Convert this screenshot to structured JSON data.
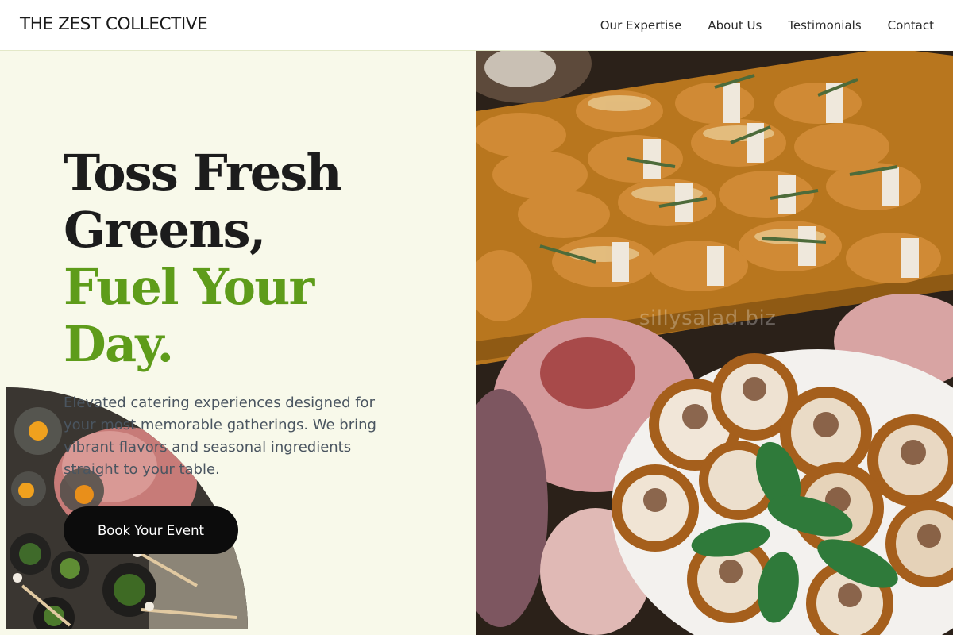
{
  "header": {
    "brand": "THE ZEST COLLECTIVE",
    "nav": [
      {
        "label": "Our Expertise"
      },
      {
        "label": "About Us"
      },
      {
        "label": "Testimonials"
      },
      {
        "label": "Contact"
      }
    ]
  },
  "hero": {
    "headline_line1": "Toss Fresh",
    "headline_line2": "Greens,",
    "headline_line3": "Fuel Your",
    "headline_line4": "Day.",
    "description": "Elevated catering experiences designed for your most memorable gatherings. We bring vibrant flavors and seasonal ingredients straight to your table.",
    "cta_label": "Book Your Event",
    "watermark": "sillysalad.biz"
  },
  "colors": {
    "background": "#f8f9ea",
    "accent_green": "#5e9c1a",
    "headline": "#1c1c1c",
    "button": "#0c0c0c"
  }
}
